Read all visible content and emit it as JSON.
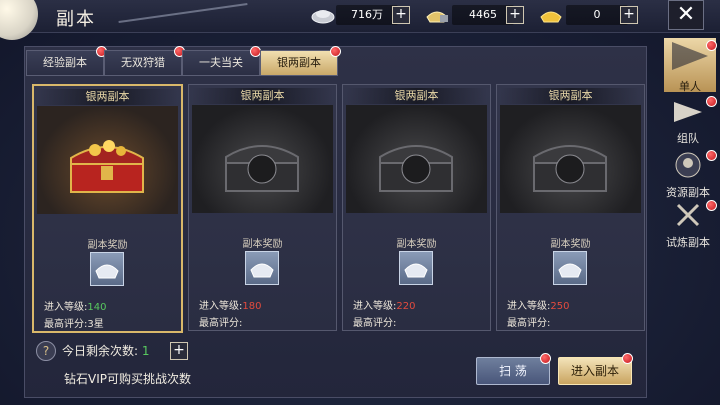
{
  "header": {
    "title": "副本",
    "resources": [
      {
        "icon": "silver-coin-icon",
        "value": "716万"
      },
      {
        "icon": "silver-ingot-lock-icon",
        "value": "4465"
      },
      {
        "icon": "gold-ingot-icon",
        "value": "0"
      }
    ],
    "plus": "+",
    "close": "✕"
  },
  "tabs": [
    {
      "label": "经验副本",
      "active": false
    },
    {
      "label": "无双狩猎",
      "active": false
    },
    {
      "label": "一夫当关",
      "active": false
    },
    {
      "label": "银两副本",
      "active": true
    }
  ],
  "cards": [
    {
      "title": "银两副本",
      "reward_label": "副本奖励",
      "level_label": "进入等级:",
      "level": "140",
      "score_label": "最高评分:",
      "score": "3星",
      "locked": false
    },
    {
      "title": "银两副本",
      "reward_label": "副本奖励",
      "level_label": "进入等级:",
      "level": "180",
      "score_label": "最高评分:",
      "score": "",
      "locked": true
    },
    {
      "title": "银两副本",
      "reward_label": "副本奖励",
      "level_label": "进入等级:",
      "level": "220",
      "score_label": "最高评分:",
      "score": "",
      "locked": true
    },
    {
      "title": "银两副本",
      "reward_label": "副本奖励",
      "level_label": "进入等级:",
      "level": "250",
      "score_label": "最高评分:",
      "score": "",
      "locked": true
    }
  ],
  "bottom": {
    "help": "?",
    "remaining_label": "今日剩余次数:",
    "remaining_value": "1",
    "plus": "+",
    "vip_note": "钻石VIP可购买挑战次数",
    "sweep_button": "扫 荡",
    "enter_button": "进入副本"
  },
  "sidebar": [
    {
      "label": "单人",
      "icon": "single-player-flag-icon",
      "active": true
    },
    {
      "label": "组队",
      "icon": "team-flag-icon",
      "active": false
    },
    {
      "label": "资源副本",
      "icon": "resource-dungeon-icon",
      "active": false
    },
    {
      "label": "试炼副本",
      "icon": "trial-swords-icon",
      "active": false
    }
  ]
}
